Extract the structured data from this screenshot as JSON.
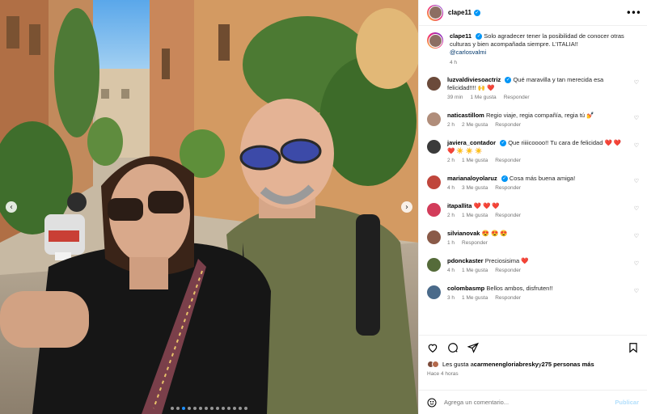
{
  "post": {
    "author": "clape11",
    "caption": "Solo agradecer tener la posibilidad de conocer otras culturas y bien acompañada siempre. L'ITALIA!!",
    "mention": "@carlosvalmi",
    "caption_time": "4 h"
  },
  "comments": [
    {
      "user": "luzvaldiviesoactriz",
      "verified": true,
      "text": "Qué maravilla y tan merecida esa felicidad!!!! 🙌 ❤️",
      "time": "39 min",
      "likes": "1 Me gusta",
      "reply": "Responder",
      "avatar_color": "#6b4a3a"
    },
    {
      "user": "naticastillom",
      "verified": false,
      "text": "Regio viaje, regia compañía, regia tú 💅",
      "time": "2 h",
      "likes": "2 Me gusta",
      "reply": "Responder",
      "avatar_color": "#b08d7a"
    },
    {
      "user": "javiera_contador",
      "verified": true,
      "text": "Que riiiicoooo!! Tu cara de felicidad ❤️ ❤️ ❤️ ☀️ ☀️ ☀️",
      "time": "2 h",
      "likes": "1 Me gusta",
      "reply": "Responder",
      "avatar_color": "#3a3a3a"
    },
    {
      "user": "marianaloyolaruz",
      "verified": true,
      "text": "Cosa más buena amiga!",
      "time": "4 h",
      "likes": "3 Me gusta",
      "reply": "Responder",
      "avatar_color": "#c0463c"
    },
    {
      "user": "itapallita",
      "verified": false,
      "text": "❤️ ❤️ ❤️",
      "time": "2 h",
      "likes": "1 Me gusta",
      "reply": "Responder",
      "avatar_color": "#d23c5a"
    },
    {
      "user": "silvianovak",
      "verified": false,
      "text": "😍 😍 😍",
      "time": "1 h",
      "likes": "",
      "reply": "Responder",
      "avatar_color": "#8a5a48"
    },
    {
      "user": "pdonckaster",
      "verified": false,
      "text": "Preciosisima ❤️",
      "time": "4 h",
      "likes": "1 Me gusta",
      "reply": "Responder",
      "avatar_color": "#556b3a"
    },
    {
      "user": "colombasmp",
      "verified": false,
      "text": "Bellos ambos, disfruten!!",
      "time": "3 h",
      "likes": "1 Me gusta",
      "reply": "Responder",
      "avatar_color": "#4a6a8a"
    }
  ],
  "likes": {
    "prefix": "Les gusta a ",
    "user": "carmenengloriabresky",
    "middle": " y ",
    "others": "275 personas más"
  },
  "post_time": "Hace 4 horas",
  "add_comment": {
    "placeholder": "Agrega un comentario...",
    "publish_label": "Publicar"
  },
  "icons": {
    "prev": "chevron-left-icon",
    "next": "chevron-right-icon",
    "more": "more-icon",
    "like": "heart-icon",
    "comment": "comment-icon",
    "share": "share-icon",
    "save": "bookmark-icon",
    "emoji": "emoji-icon"
  },
  "carousel": {
    "count": 14,
    "active": 2
  },
  "colors": {
    "accent": "#0095f6",
    "link": "#00376b",
    "muted": "#737373",
    "publish": "#b2dffc"
  }
}
